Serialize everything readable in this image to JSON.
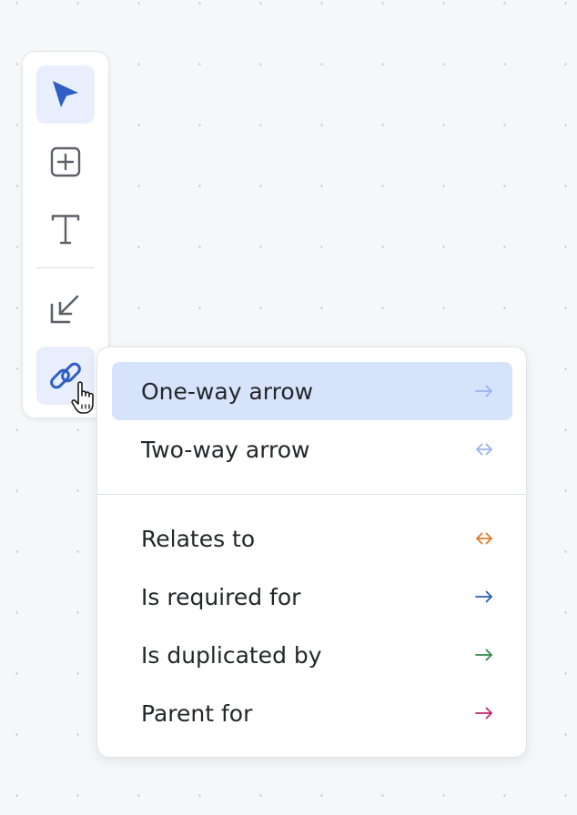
{
  "toolbar": {
    "tools": [
      {
        "name": "select",
        "icon": "cursor-arrow-icon",
        "active": true
      },
      {
        "name": "add-element",
        "icon": "plus-square-icon",
        "active": false
      },
      {
        "name": "text",
        "icon": "text-t-icon",
        "active": false
      },
      {
        "name": "collapse",
        "icon": "arrow-down-left-icon",
        "active": false
      },
      {
        "name": "link",
        "icon": "link-icon",
        "active": true
      }
    ]
  },
  "menu": {
    "arrow_items": [
      {
        "label": "One-way arrow",
        "icon": "arrow-right-icon",
        "color": "#9ab3ee",
        "highlighted": true
      },
      {
        "label": "Two-way arrow",
        "icon": "arrow-left-right-icon",
        "color": "#9ab3ee",
        "highlighted": false
      }
    ],
    "relation_items": [
      {
        "label": "Relates to",
        "icon": "arrow-left-right-icon",
        "color": "#e07a2a"
      },
      {
        "label": "Is required for",
        "icon": "arrow-right-icon",
        "color": "#2f5db6"
      },
      {
        "label": "Is duplicated by",
        "icon": "arrow-right-icon",
        "color": "#2f8a47"
      },
      {
        "label": "Parent for",
        "icon": "arrow-right-icon",
        "color": "#c2286f"
      }
    ]
  },
  "colors": {
    "accent": "#2f5ec4",
    "icon_gray": "#5c6068",
    "highlight": "#d6e3fb"
  }
}
